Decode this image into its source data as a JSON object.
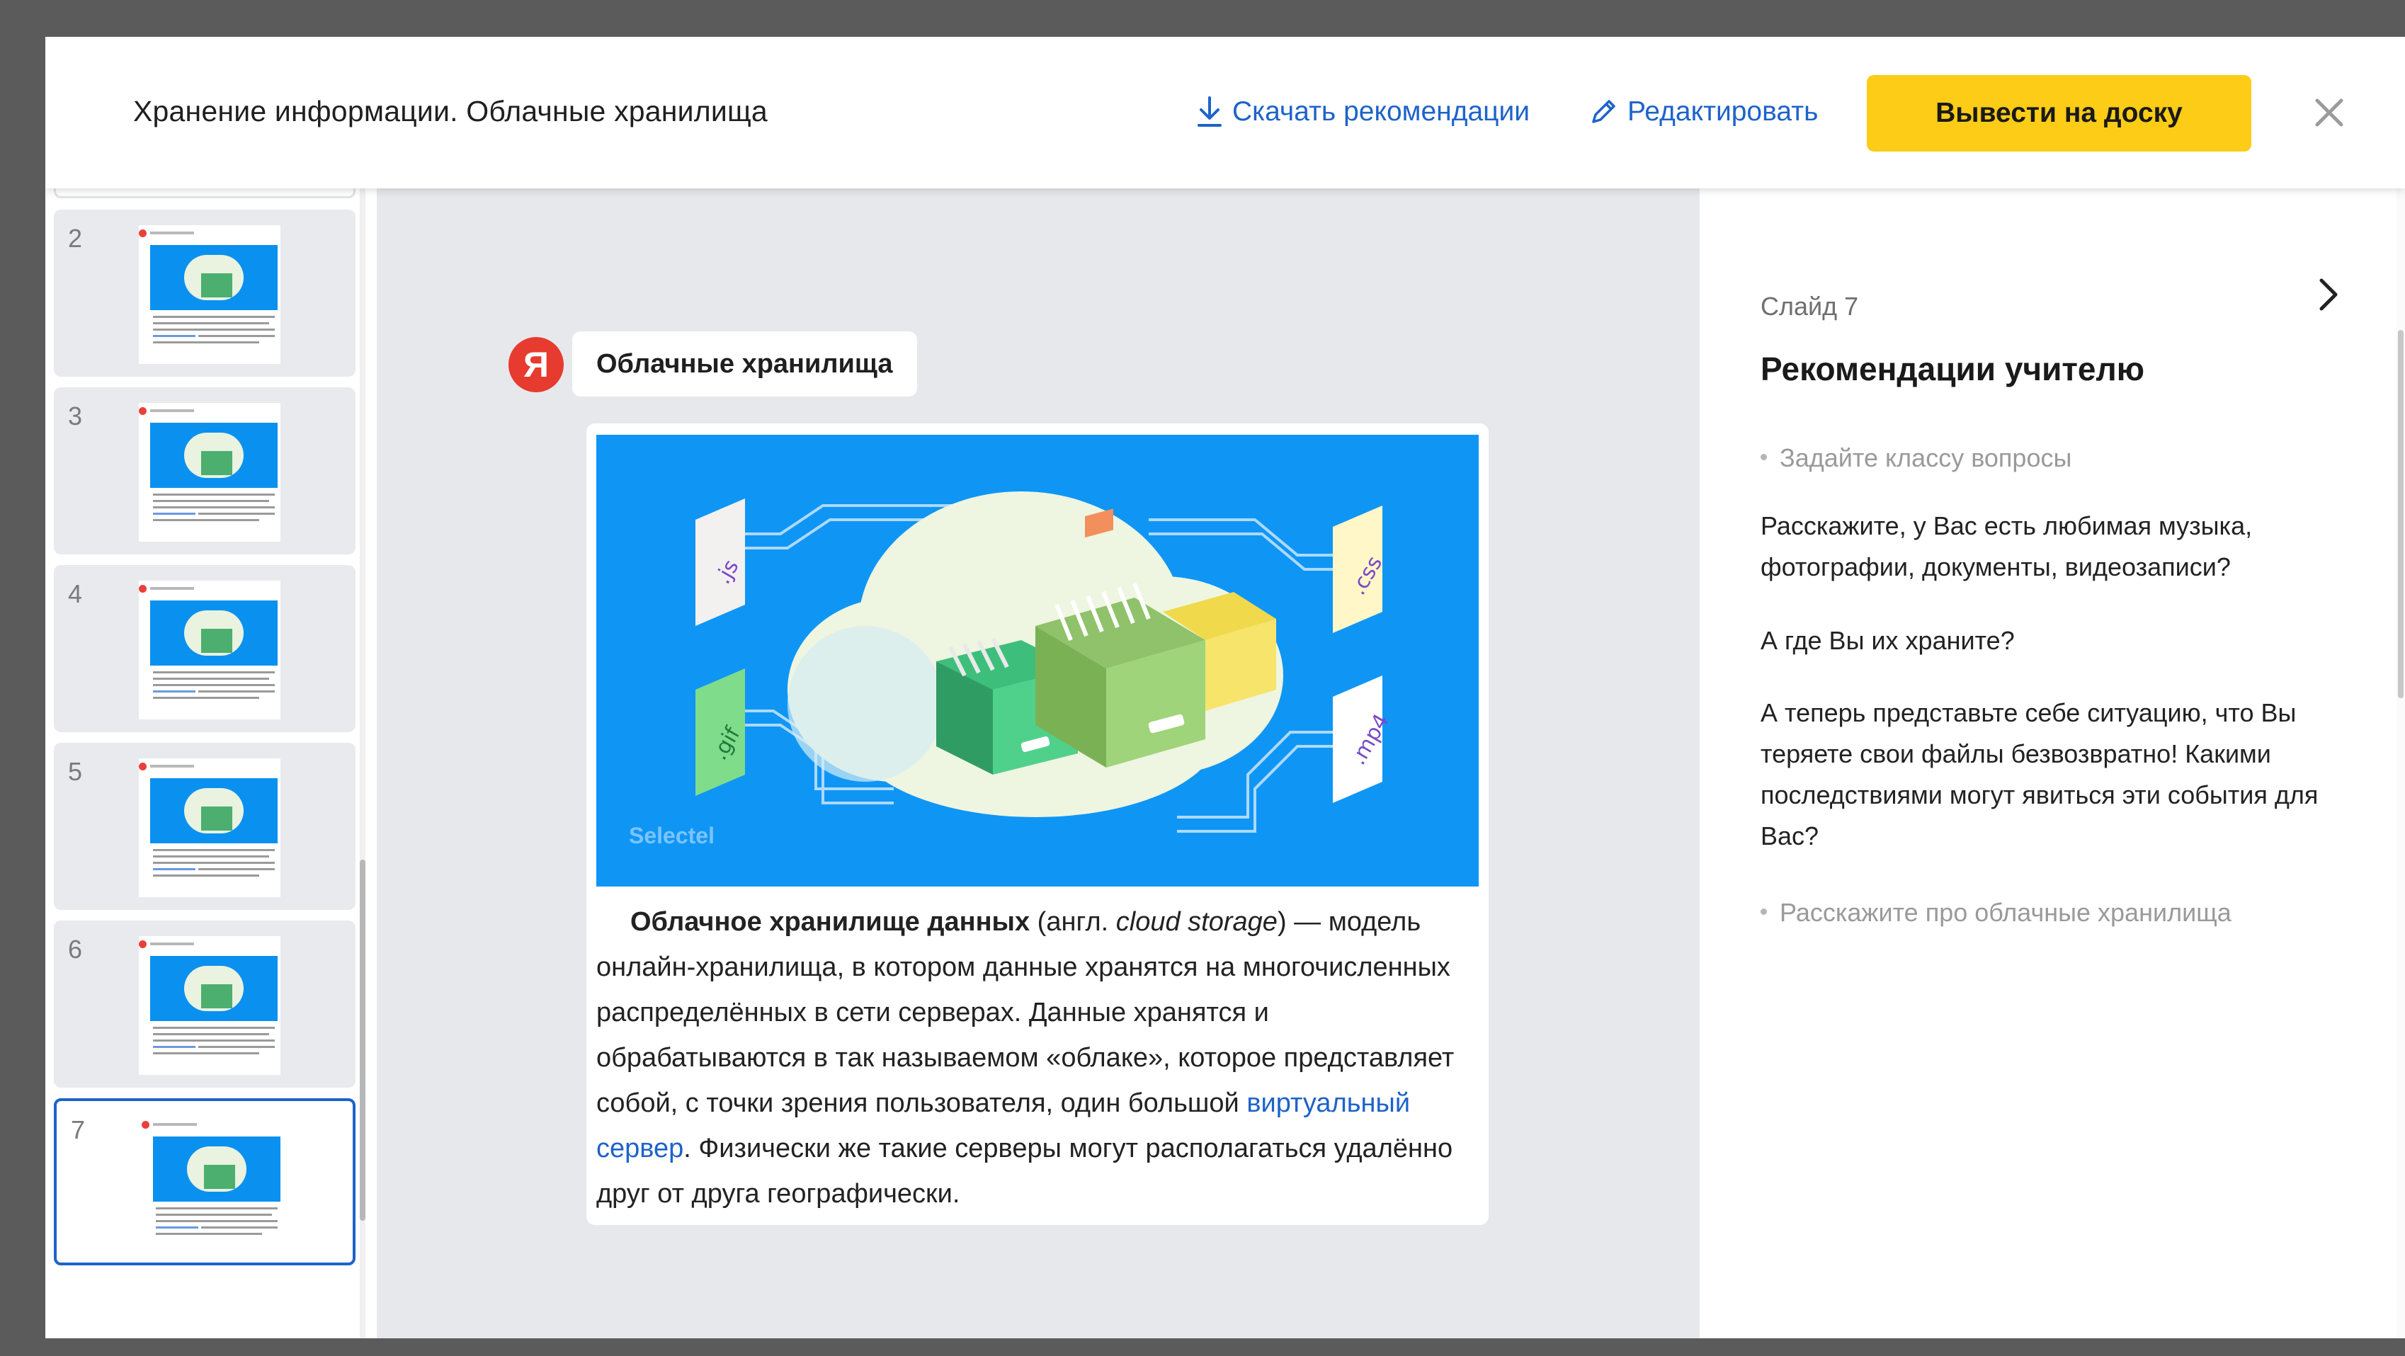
{
  "header": {
    "title": "Хранение информации. Облачные хранилища",
    "download_label": "Скачать рекомендации",
    "edit_label": "Редактировать",
    "board_button_label": "Вывести на доску"
  },
  "thumbnails": [
    {
      "num": "2"
    },
    {
      "num": "3"
    },
    {
      "num": "4"
    },
    {
      "num": "5"
    },
    {
      "num": "6"
    },
    {
      "num": "7",
      "active": true
    }
  ],
  "slide": {
    "logo_letter": "Я",
    "title": "Облачные хранилища",
    "image_labels": {
      "js": ".js",
      "gif": ".gif",
      "css": ".css",
      "mp4": ".mp4",
      "watermark": "Selectel"
    },
    "text": {
      "term": "Облачное хранилище данных",
      "paren_open": " (англ. ",
      "term_en": "cloud storage",
      "def_a": ") — модель онлайн-хранилища, в котором данные хранятся на многочисленных распределённых в сети серверах. Данные хранятся и обрабатываются в так называемом «облаке», которое представляет собой, с точки зрения пользователя, один большой ",
      "link": "виртуальный сервер",
      "def_b": ". Физически же такие серверы могут располагаться удалённо друг от друга географически."
    }
  },
  "recommendations": {
    "slide_label": "Слайд 7",
    "title": "Рекомендации учителю",
    "bullet1": "Задайте классу вопросы",
    "para1": "Расскажите, у Вас есть любимая музыка, фотографии, документы, видеозаписи?",
    "para2": "А где Вы их храните?",
    "para3": "А теперь представьте себе ситуацию, что Вы теряете свои файлы безвозвратно! Какими последствиями могут явиться эти события для Вас?",
    "bullet2": "Расскажите про облачные хранилища"
  },
  "colors": {
    "accent_yellow": "#fccc16",
    "link_blue": "#1e63c9",
    "yandex_red": "#e63b2e",
    "image_blue": "#0f96f5"
  },
  "icons": [
    "download-icon",
    "pencil-icon",
    "close-icon",
    "chevron-right-icon"
  ]
}
